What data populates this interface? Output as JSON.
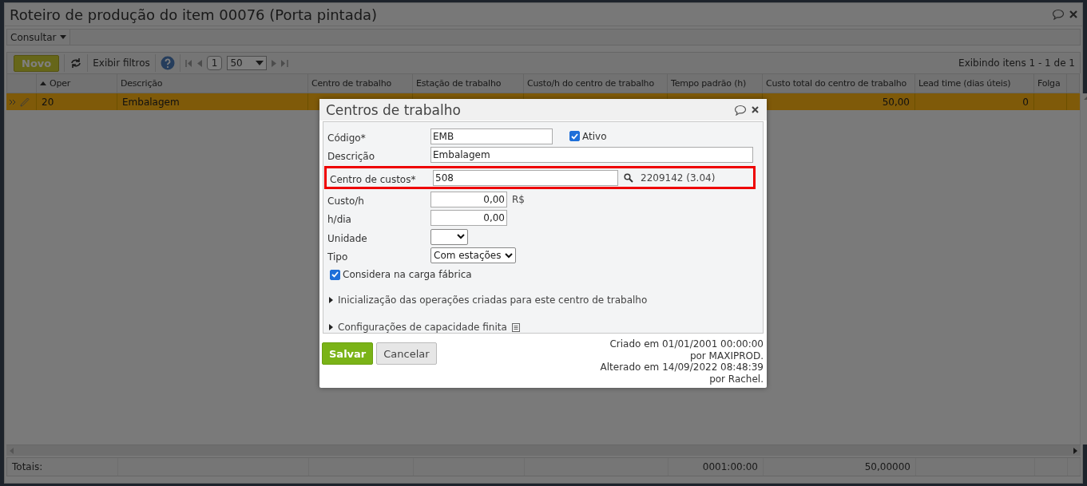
{
  "window": {
    "title": "Roteiro de produção do item 00076 (Porta pintada)"
  },
  "menu": [
    {
      "label": "Consultar"
    }
  ],
  "toolbar": {
    "new_button": "Novo",
    "filters_button": "Exibir filtros",
    "page": "1",
    "page_size": "50",
    "summary": "Exibindo itens 1 - 1 de 1"
  },
  "table": {
    "columns": [
      {
        "label": "Oper",
        "sorted": true
      },
      {
        "label": "Descrição",
        "sorted": false
      },
      {
        "label": "Centro de trabalho",
        "sorted": false
      },
      {
        "label": "Estação de trabalho",
        "sorted": false
      },
      {
        "label": "Custo/h do centro de trabalho",
        "sorted": false
      },
      {
        "label": "Tempo padrão (h)",
        "sorted": false
      },
      {
        "label": "Custo total do centro de trabalho",
        "sorted": false
      },
      {
        "label": "Lead time (dias úteis)",
        "sorted": false
      },
      {
        "label": "Folga",
        "sorted": false
      }
    ],
    "rows": [
      {
        "selected": true,
        "cells": [
          "20",
          "Embalagem",
          null,
          null,
          null,
          null,
          "50,00",
          "0",
          null
        ]
      }
    ],
    "totals": {
      "label": "Totais:",
      "cells": [
        null,
        null,
        null,
        null,
        null,
        "0001:00:00",
        "50,00000",
        null,
        null
      ]
    }
  },
  "dialog": {
    "title": "Centros de trabalho",
    "fields": [
      {
        "kind": "code",
        "label": "Código*",
        "value": "EMB",
        "checkbox": {
          "label": "Ativo",
          "checked": true
        }
      },
      {
        "kind": "text",
        "label": "Descrição",
        "value": "Embalagem"
      },
      {
        "kind": "lookup",
        "label": "Centro de custos*",
        "value": "508",
        "info": "2209142 (3.04)",
        "highlighted": true
      },
      {
        "kind": "number",
        "label": "Custo/h",
        "value": "0,00",
        "unit": "R$"
      },
      {
        "kind": "number",
        "label": "h/dia",
        "value": "0,00"
      },
      {
        "kind": "select",
        "label": "Unidade"
      },
      {
        "kind": "select",
        "label": "Tipo",
        "value": "Com estações"
      }
    ],
    "checkboxes": [
      {
        "label": "Considera na carga fábrica",
        "checked": true
      }
    ],
    "sections": [
      {
        "label": "Inicialização das operações criadas para este centro de trabalho",
        "expanded": false,
        "note_icon": false
      },
      {
        "label": "Configurações de capacidade finita",
        "expanded": false,
        "note_icon": true
      }
    ],
    "buttons": [
      {
        "label": "Salvar",
        "kind": "primary"
      },
      {
        "label": "Cancelar",
        "kind": "secondary"
      }
    ],
    "audit": [
      "Criado em 01/01/2001 00:00:00",
      "por MAXIPROD.",
      "Alterado em 14/09/2022 08:48:39",
      "por Rachel."
    ]
  }
}
